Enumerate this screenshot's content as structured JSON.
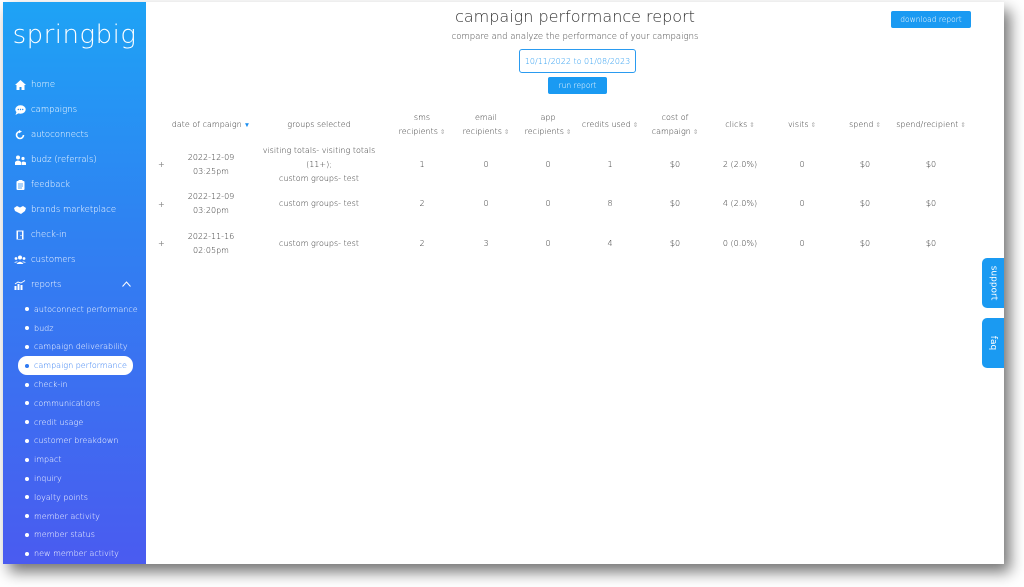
{
  "app": {
    "logo": "springbig"
  },
  "sidebar": {
    "items": [
      {
        "label": "home",
        "icon": "home-icon"
      },
      {
        "label": "campaigns",
        "icon": "chat-icon"
      },
      {
        "label": "autoconnects",
        "icon": "refresh-icon"
      },
      {
        "label": "budz (referrals)",
        "icon": "referral-icon"
      },
      {
        "label": "feedback",
        "icon": "clipboard-icon"
      },
      {
        "label": "brands marketplace",
        "icon": "handshake-icon"
      },
      {
        "label": "check-in",
        "icon": "door-icon"
      },
      {
        "label": "customers",
        "icon": "users-icon"
      },
      {
        "label": "reports",
        "icon": "chart-icon"
      }
    ],
    "reports_sub": [
      "autoconnect performance",
      "budz",
      "campaign deliverability",
      "campaign performance",
      "check-in",
      "communications",
      "credit usage",
      "customer breakdown",
      "impact",
      "inquiry",
      "loyalty points",
      "member activity",
      "member status",
      "new member activity"
    ],
    "active_sub": "campaign performance"
  },
  "header": {
    "title": "campaign performance report",
    "subtitle": "compare and analyze the performance of your campaigns",
    "date_range": "10/11/2022 to 01/08/2023",
    "run_label": "run report",
    "download_label": "download report"
  },
  "table": {
    "headers": [
      {
        "l1": "",
        "l2": "date of campaign"
      },
      {
        "l1": "",
        "l2": "groups selected"
      },
      {
        "l1": "",
        "l2": "sms recipients"
      },
      {
        "l1": "email",
        "l2": "recipients"
      },
      {
        "l1": "",
        "l2": "app recipients"
      },
      {
        "l1": "",
        "l2": "credits used"
      },
      {
        "l1": "cost of",
        "l2": "campaign"
      },
      {
        "l1": "",
        "l2": "clicks"
      },
      {
        "l1": "",
        "l2": "visits"
      },
      {
        "l1": "",
        "l2": "spend"
      },
      {
        "l1": "",
        "l2": "spend/recipient"
      }
    ],
    "rows": [
      {
        "date": "2022-12-09",
        "time": "03:25pm",
        "groups1": "visiting totals- visiting totals (11+);",
        "groups2": "custom groups- test",
        "sms": "1",
        "email": "0",
        "app": "0",
        "credits": "1",
        "cost": "$0",
        "clicks": "2 (2.0%)",
        "visits": "0",
        "spend": "$0",
        "spr": "$0"
      },
      {
        "date": "2022-12-09",
        "time": "03:20pm",
        "groups1": "custom groups- test",
        "groups2": "",
        "sms": "2",
        "email": "0",
        "app": "0",
        "credits": "8",
        "cost": "$0",
        "clicks": "4 (2.0%)",
        "visits": "0",
        "spend": "$0",
        "spr": "$0"
      },
      {
        "date": "2022-11-16",
        "time": "02:05pm",
        "groups1": "custom groups- test",
        "groups2": "",
        "sms": "2",
        "email": "3",
        "app": "0",
        "credits": "4",
        "cost": "$0",
        "clicks": "0 (0.0%)",
        "visits": "0",
        "spend": "$0",
        "spr": "$0"
      }
    ],
    "expander": "+"
  },
  "side_tabs": {
    "support": "support",
    "faq": "faq"
  },
  "colors": {
    "accent": "#1a9af2",
    "sidebar_top": "#1ea3f5",
    "sidebar_bottom": "#4a5bf0"
  }
}
